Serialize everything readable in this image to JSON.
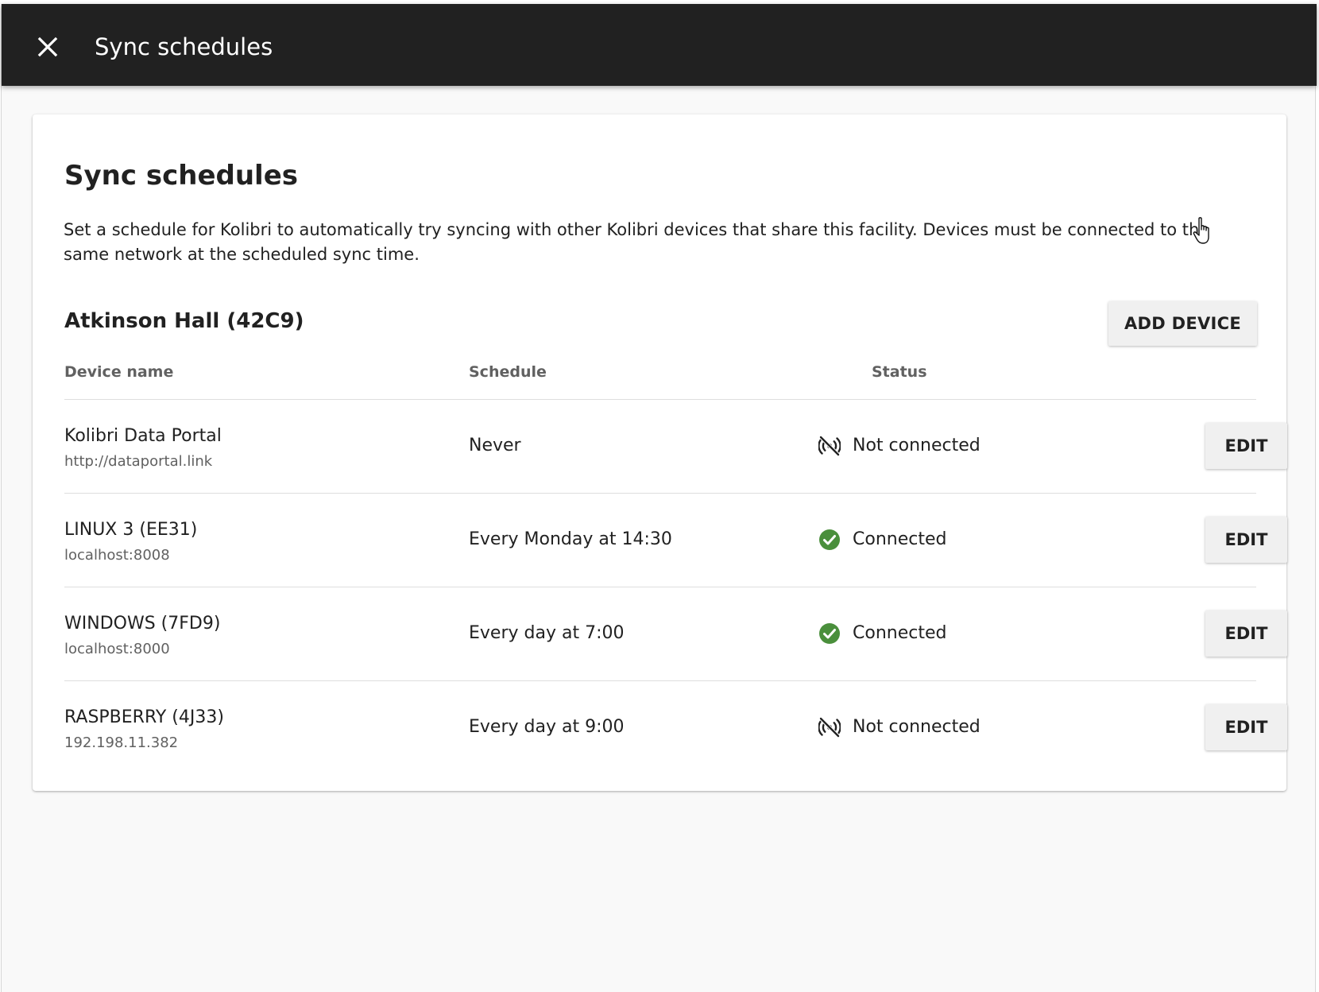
{
  "appbar": {
    "title": "Sync schedules",
    "close_icon": "close-icon"
  },
  "card": {
    "title": "Sync schedules",
    "description": "Set a schedule for Kolibri to automatically try syncing with other Kolibri devices that share this facility. Devices must be connected to the same network at the scheduled sync time.",
    "facility_name": "Atkinson Hall (42C9)",
    "add_device_label": "ADD DEVICE"
  },
  "table": {
    "headers": {
      "device_name": "Device name",
      "schedule": "Schedule",
      "status": "Status"
    },
    "rows": [
      {
        "name": "Kolibri Data Portal",
        "address": "http://dataportal.link",
        "schedule": "Never",
        "status": "Not connected",
        "status_icon": "not-connected-icon",
        "edit_label": "EDIT"
      },
      {
        "name": "LINUX 3 (EE31)",
        "address": "localhost:8008",
        "schedule": "Every Monday at 14:30",
        "status": "Connected",
        "status_icon": "check-circle-icon",
        "edit_label": "EDIT"
      },
      {
        "name": "WINDOWS (7FD9)",
        "address": "localhost:8000",
        "schedule": "Every day at 7:00",
        "status": "Connected",
        "status_icon": "check-circle-icon",
        "edit_label": "EDIT"
      },
      {
        "name": "RASPBERRY (4J33)",
        "address": "192.198.11.382",
        "schedule": "Every day at 9:00",
        "status": "Not connected",
        "status_icon": "not-connected-icon",
        "edit_label": "EDIT"
      }
    ]
  },
  "colors": {
    "appbar_bg": "#212121",
    "page_bg": "#f9f9f9",
    "connected_green": "#4a8f3c",
    "button_bg": "#f0f0f0"
  }
}
